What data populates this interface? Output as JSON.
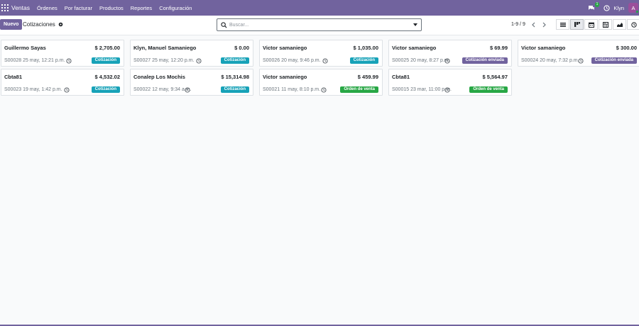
{
  "navbar": {
    "brand": "Ventas",
    "menu": [
      "Órdenes",
      "Por facturar",
      "Productos",
      "Reportes",
      "Configuración"
    ],
    "chat_count": "1",
    "user": "Klyn",
    "avatar_letter": "A",
    "color": "#71639e"
  },
  "control": {
    "new_label": "Nuevo",
    "title": "Cotizaciones",
    "search_placeholder": "Buscar...",
    "pager": "1-9 / 9"
  },
  "cards": [
    {
      "name": "Guillermo Sayas",
      "amount": "$ 2,705.00",
      "ref": "S00028 25 may, 12:21 p.m.",
      "status": "Cotización",
      "kind": "cot"
    },
    {
      "name": "Klyn, Manuel Samaniego",
      "amount": "$ 0.00",
      "ref": "S00027 25 may, 12:20 p.m.",
      "status": "Cotización",
      "kind": "cot"
    },
    {
      "name": "Victor samaniego",
      "amount": "$ 1,035.00",
      "ref": "S00026 20 may, 9:46 p.m.",
      "status": "Cotización",
      "kind": "cot"
    },
    {
      "name": "Victor samaniego",
      "amount": "$ 69.99",
      "ref": "S00025 20 may, 8:27 p.m.",
      "status": "Cotización enviada",
      "kind": "env"
    },
    {
      "name": "Victor samaniego",
      "amount": "$ 300.00",
      "ref": "S00024 20 may, 7:32 p.m.",
      "status": "Cotización enviada",
      "kind": "env"
    },
    {
      "name": "Cbta81",
      "amount": "$ 4,532.02",
      "ref": "S00023 19 may, 1:42 p.m.",
      "status": "Cotización",
      "kind": "cot"
    },
    {
      "name": "Conalep Los Mochis",
      "amount": "$ 15,314.98",
      "ref": "S00022 12 may, 9:34 a.m.",
      "status": "Cotización",
      "kind": "cot"
    },
    {
      "name": "Victor samaniego",
      "amount": "$ 459.99",
      "ref": "S00021 11 may, 8:10 p.m.",
      "status": "Orden de venta",
      "kind": "ord"
    },
    {
      "name": "Cbta81",
      "amount": "$ 5,564.97",
      "ref": "S00015 23 mar, 11:00 p.m.",
      "status": "Orden de venta",
      "kind": "ord"
    }
  ],
  "colors": {
    "cotizacion": "#17a2b8",
    "enviada": "#71639e",
    "orden": "#28a745"
  }
}
